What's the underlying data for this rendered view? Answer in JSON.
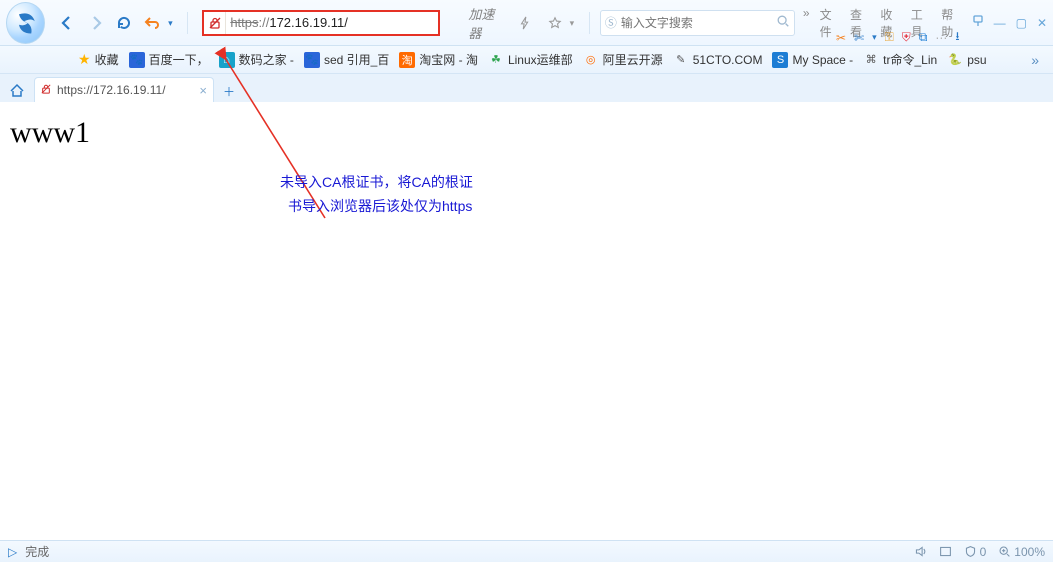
{
  "menu": {
    "arrow": "»",
    "file": "文件",
    "view": "查看",
    "fav": "收藏",
    "tool": "工具",
    "help": "帮助"
  },
  "address": {
    "scheme": "https",
    "sep": "://",
    "host": "172.16.19.11/",
    "accel": "加速器"
  },
  "search": {
    "placeholder": "输入文字搜索"
  },
  "bookmarks": {
    "favorites": "收藏",
    "items": [
      {
        "label": "百度一下，"
      },
      {
        "label": "数码之家 -"
      },
      {
        "label": "sed 引用_百"
      },
      {
        "label": "淘宝网 - 淘"
      },
      {
        "label": "Linux运维部"
      },
      {
        "label": "阿里云开源"
      },
      {
        "label": "51CTO.COM"
      },
      {
        "label": "My Space -"
      },
      {
        "label": "tr命令_Lin"
      },
      {
        "label": "psu"
      }
    ]
  },
  "tab": {
    "title": "https://172.16.19.11/"
  },
  "page": {
    "heading": "www1",
    "anno_line1": "未导入CA根证书，将CA的根证",
    "anno_line2": "书导入浏览器后该处仅为https"
  },
  "status": {
    "done": "完成",
    "shield": "0",
    "zoom": "100%"
  }
}
